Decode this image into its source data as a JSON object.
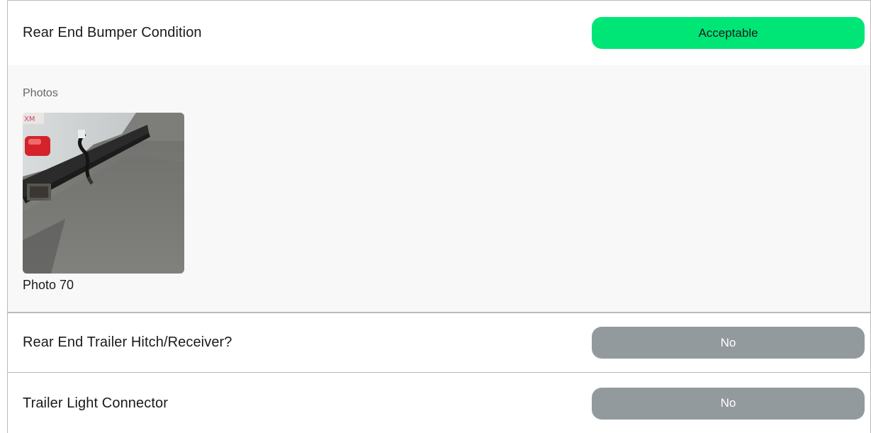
{
  "sections": [
    {
      "title": "Rear End Bumper Condition",
      "status": "Acceptable",
      "status_color": "#00e676",
      "photos_label": "Photos",
      "photos": [
        {
          "caption": "Photo 70",
          "icon": "trailer-bumper-photo"
        }
      ]
    },
    {
      "title": "Rear End Trailer Hitch/Receiver?",
      "status": "No",
      "status_color": "#939a9e"
    },
    {
      "title": "Trailer Light Connector",
      "status": "No",
      "status_color": "#939a9e"
    }
  ]
}
